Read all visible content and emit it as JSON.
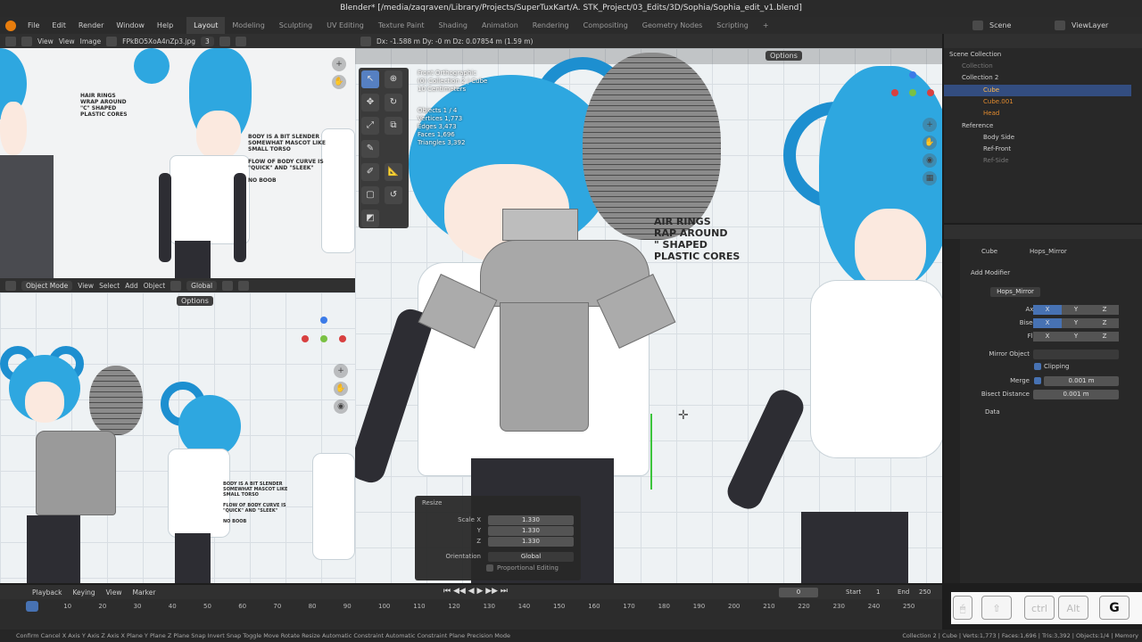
{
  "window": {
    "title": "Blender* [/media/zaqraven/Library/Projects/SuperTuxKart/A. STK_Project/03_Edits/3D/Sophia/Sophia_edit_v1.blend]",
    "scene": "Scene",
    "view_layer": "ViewLayer"
  },
  "menu": {
    "items": [
      "File",
      "Edit",
      "Render",
      "Window",
      "Help"
    ],
    "workspaces": [
      "Layout",
      "Modeling",
      "Sculpting",
      "UV Editing",
      "Texture Paint",
      "Shading",
      "Animation",
      "Rendering",
      "Compositing",
      "Geometry Nodes",
      "Scripting"
    ],
    "add_tab": "+"
  },
  "image_editor": {
    "header": [
      "View",
      "View",
      "Image"
    ],
    "image_name": "FPkBO5XoA4nZp3.jpg",
    "users": "3",
    "notes": {
      "hair": "HAIR RINGS\nWRAP AROUND\n\"C\" SHAPED\nPLASTIC CORES",
      "body": "BODY IS A BIT SLENDER\nSOMEWHAT MASCOT LIKE\nSMALL TORSO\n\nFLOW OF BODY CURVE IS\n\"QUICK\" AND \"SLEEK\"\n\nNO BOOB"
    }
  },
  "small_viewport": {
    "mode": "Object Mode",
    "menus": [
      "View",
      "Select",
      "Add",
      "Object"
    ],
    "orientation": "Global",
    "options": "Options"
  },
  "main_viewport": {
    "header_status": "Dx: -1.588 m  Dy: -0 m  Dz: 0.07854 m (1.59 m)",
    "options": "Options",
    "overlay": {
      "view": "Front Orthographic",
      "collection": "(0) Collection 2 | Cube",
      "scale": "10 Centimeters",
      "stats": "Objects 1 / 4\nVertices 1,773\nEdges 3,473\nFaces 1,696\nTriangles 3,392"
    },
    "notes": "AIR RINGS\nRAP AROUND\n\" SHAPED\nPLASTIC CORES"
  },
  "redo_panel": {
    "title": "Resize",
    "scale_label": "Scale X",
    "y_label": "Y",
    "z_label": "Z",
    "x": "1.330",
    "y": "1.330",
    "z": "1.330",
    "orientation_label": "Orientation",
    "orientation": "Global",
    "proportional": "Proportional Editing"
  },
  "outliner": {
    "rows": [
      {
        "label": "Scene Collection"
      },
      {
        "label": "Collection"
      },
      {
        "label": "Collection 2"
      },
      {
        "label": "Cube"
      },
      {
        "label": "Cube.001"
      },
      {
        "label": "Head"
      },
      {
        "label": "Reference"
      },
      {
        "label": "Body Side"
      },
      {
        "label": "Ref-Front"
      },
      {
        "label": "Ref-Side"
      }
    ]
  },
  "properties": {
    "object": "Cube",
    "modifier_name": "Hops_Mirror",
    "add_modifier": "Add Modifier",
    "axis_label": "Axis",
    "bisect_label": "Bisect",
    "flip_label": "Flip",
    "x": "X",
    "y": "Y",
    "z": "Z",
    "mirror_object": "Mirror Object",
    "clipping": "Clipping",
    "merge": "Merge",
    "merge_value": "0.001 m",
    "bisect_distance": "Bisect Distance",
    "bisect_value": "0.001 m",
    "data": "Data"
  },
  "timeline": {
    "menus": [
      "Playback",
      "Keying",
      "View",
      "Marker"
    ],
    "current": "0",
    "start_label": "Start",
    "start": "1",
    "end_label": "End",
    "end": "250",
    "ticks": [
      "0",
      "10",
      "20",
      "30",
      "40",
      "50",
      "60",
      "70",
      "80",
      "90",
      "100",
      "110",
      "120",
      "130",
      "140",
      "150",
      "160",
      "170",
      "180",
      "190",
      "200",
      "210",
      "220",
      "230",
      "240",
      "250"
    ]
  },
  "statusbar": {
    "left": "Confirm   Cancel   X Axis   Y Axis   Z Axis   X Plane   Y Plane   Z Plane   Snap Invert   Snap Toggle   Move   Rotate   Resize   Automatic Constraint   Automatic Constraint Plane   Precision Mode",
    "right": "Collection 2 | Cube | Verts:1,773 | Faces:1,696 | Tris:3,392 | Objects:1/4 | Memory"
  },
  "keys": [
    "ctrl",
    "Alt",
    "G"
  ]
}
